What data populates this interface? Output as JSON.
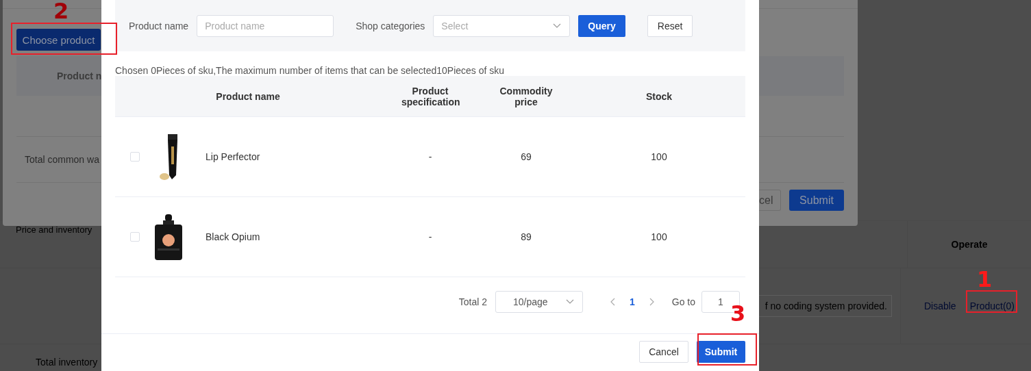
{
  "background_page": {
    "section_label": "Price and inventory",
    "table": {
      "columns": [
        "Operate"
      ],
      "rows": [
        {
          "code_field": "f no coding system provided.",
          "actions": [
            "Disable",
            "Product(0)"
          ]
        }
      ]
    },
    "footer_label": "Total inventory"
  },
  "behind_dialog": {
    "choose_button": "Choose product",
    "table": {
      "columns": [
        "Product n"
      ],
      "rows": [
        {
          "label": "Total common wa"
        }
      ]
    },
    "buttons": [
      {
        "label": "cel",
        "primary": false
      },
      {
        "label": "Submit",
        "primary": true
      }
    ]
  },
  "dialog": {
    "filters": [
      {
        "label": "Product name",
        "kind": "input",
        "placeholder": "Product name"
      },
      {
        "label": "Shop categories",
        "kind": "select",
        "placeholder": "Select"
      }
    ],
    "filter_buttons": [
      {
        "label": "Query",
        "primary": true
      },
      {
        "label": "Reset",
        "primary": false
      }
    ],
    "selection_info": "Chosen 0Pieces of sku,The maximum number of items that can be selected10Pieces of sku",
    "table": {
      "columns": [
        "Product name",
        "Product specification",
        "Commodity price",
        "Stock"
      ],
      "rows": [
        {
          "checked": false,
          "kind": "tube",
          "name": "Lip Perfector",
          "specification": "-",
          "price": "69",
          "stock": "100"
        },
        {
          "checked": false,
          "kind": "bottle",
          "name": "Black Opium",
          "specification": "-",
          "price": "89",
          "stock": "100"
        }
      ]
    },
    "pagination": {
      "total": "Total 2",
      "page_size": "10/page",
      "pages": [
        {
          "label": "1",
          "selected": true
        }
      ],
      "goto_label": "Go to",
      "goto_value": "1"
    },
    "buttons": [
      {
        "label": "Cancel",
        "primary": false
      },
      {
        "label": "Submit",
        "primary": true
      }
    ]
  },
  "annotations": [
    {
      "label": "2"
    },
    {
      "label": "1"
    },
    {
      "label": "3"
    }
  ]
}
